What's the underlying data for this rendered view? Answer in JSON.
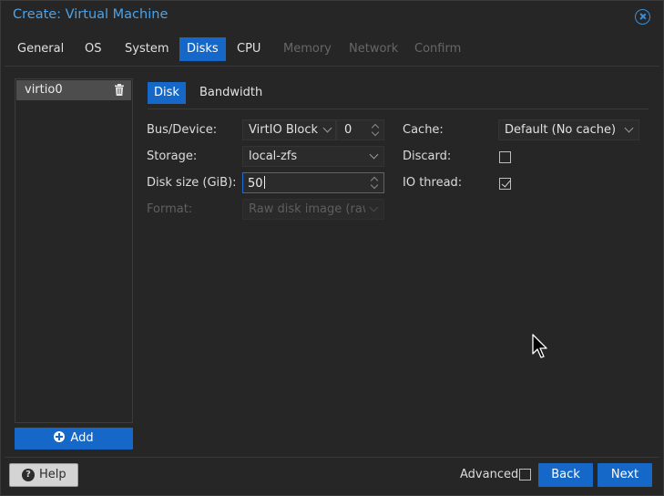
{
  "window": {
    "title": "Create: Virtual Machine"
  },
  "tabs": [
    {
      "label": "General",
      "state": "normal"
    },
    {
      "label": "OS",
      "state": "normal"
    },
    {
      "label": "System",
      "state": "normal"
    },
    {
      "label": "Disks",
      "state": "active"
    },
    {
      "label": "CPU",
      "state": "normal"
    },
    {
      "label": "Memory",
      "state": "disabled"
    },
    {
      "label": "Network",
      "state": "disabled"
    },
    {
      "label": "Confirm",
      "state": "disabled"
    }
  ],
  "disks": {
    "items": [
      {
        "label": "virtio0"
      }
    ],
    "add_label": "Add"
  },
  "subtabs": [
    {
      "label": "Disk",
      "state": "active"
    },
    {
      "label": "Bandwidth",
      "state": "normal"
    }
  ],
  "form": {
    "bus_device": {
      "label": "Bus/Device:",
      "bus": "VirtIO Block",
      "device": "0"
    },
    "storage": {
      "label": "Storage:",
      "value": "local-zfs"
    },
    "disk_size": {
      "label": "Disk size (GiB):",
      "value": "50"
    },
    "format": {
      "label": "Format:",
      "value": "Raw disk image (raw"
    },
    "cache": {
      "label": "Cache:",
      "value": "Default (No cache)"
    },
    "discard": {
      "label": "Discard:",
      "checked": false
    },
    "io_thread": {
      "label": "IO thread:",
      "checked": true
    }
  },
  "footer": {
    "help_label": "Help",
    "advanced_label": "Advanced",
    "advanced_checked": false,
    "back_label": "Back",
    "next_label": "Next"
  },
  "colors": {
    "accent": "#1668c8",
    "title": "#4aa3ea",
    "background": "#262626"
  },
  "icons": [
    "close-icon",
    "trash-icon",
    "plus-circle-icon",
    "question-circle-icon",
    "chevron-down-icon",
    "spinner-arrows-icon",
    "mouse-pointer-icon"
  ]
}
